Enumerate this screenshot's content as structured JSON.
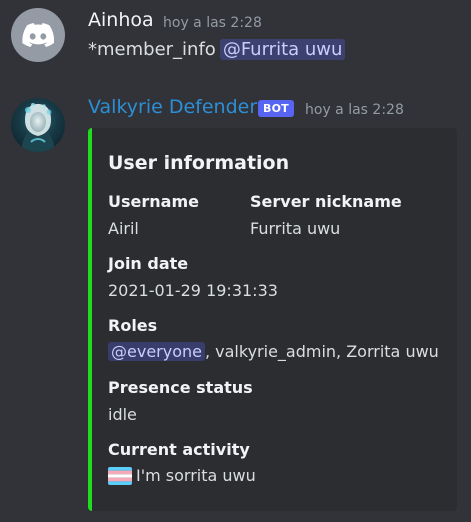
{
  "message1": {
    "username": "Ainhoa",
    "timestamp": "hoy a las 2:28",
    "text": "*member_info",
    "mention": "@Furrita uwu",
    "avatar_icon": "discord-logo-icon"
  },
  "message2": {
    "username": "Valkyrie Defender",
    "badge": "BOT",
    "timestamp": "hoy a las 2:28",
    "embed": {
      "accent_color": "#1fdc1f",
      "title": "User information",
      "fields": {
        "username_name": "Username",
        "username_value": "Airil",
        "nickname_name": "Server nickname",
        "nickname_value": "Furrita uwu",
        "join_name": "Join date",
        "join_value": "2021-01-29 19:31:33",
        "roles_name": "Roles",
        "roles_mention": "@everyone",
        "roles_rest": ", valkyrie_admin, Zorrita uwu",
        "presence_name": "Presence status",
        "presence_value": "idle",
        "activity_name": "Current activity",
        "activity_value": "I'm sorrita uwu",
        "activity_icon": "transgender-flag-icon"
      }
    }
  },
  "colors": {
    "background": "#313338",
    "embed_background": "#2b2d31",
    "bot_name": "#2c8fd6",
    "bot_badge": "#5865f2",
    "mention_text": "#c9cdfb"
  }
}
